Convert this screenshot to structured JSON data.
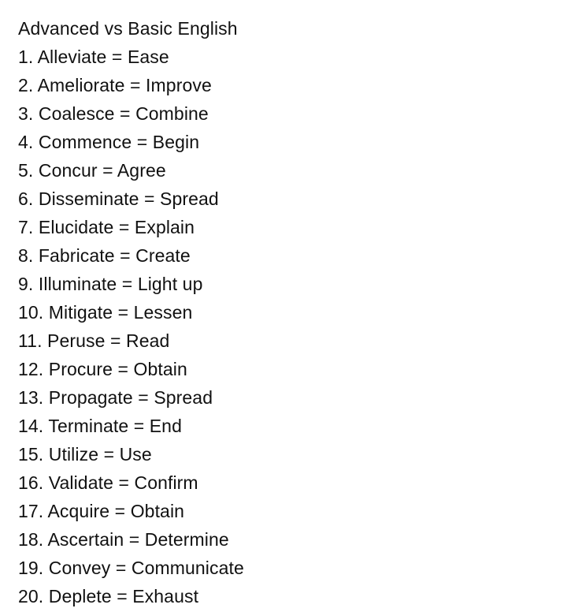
{
  "document": {
    "title": "Advanced vs Basic English",
    "items": [
      "1. Alleviate = Ease",
      "2. Ameliorate = Improve",
      "3. Coalesce = Combine",
      "4. Commence = Begin",
      "5. Concur = Agree",
      "6. Disseminate = Spread",
      "7. Elucidate = Explain",
      "8. Fabricate = Create",
      "9. Illuminate = Light up",
      "10. Mitigate = Lessen",
      "11. Peruse = Read",
      "12. Procure = Obtain",
      "13. Propagate = Spread",
      "14. Terminate = End",
      "15. Utilize = Use",
      "16. Validate = Confirm",
      "17. Acquire = Obtain",
      "18. Ascertain = Determine",
      "19. Convey = Communicate",
      "20. Deplete = Exhaust"
    ]
  }
}
